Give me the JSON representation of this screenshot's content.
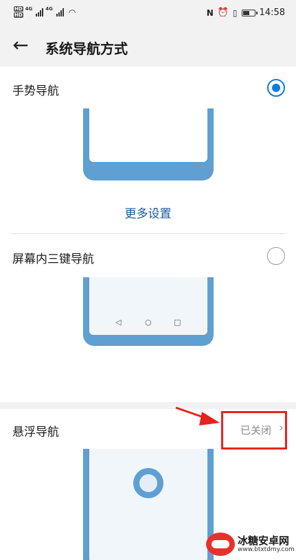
{
  "status_bar": {
    "hd_top": "HD",
    "hd_bottom": "HD",
    "network_1": "4G",
    "network_2": "4G",
    "time": "14:58",
    "icons": [
      "nfc-icon",
      "alarm-icon",
      "vibrate-icon",
      "battery-icon"
    ]
  },
  "header": {
    "title": "系统导航方式",
    "back_icon": "back-arrow-icon"
  },
  "options": {
    "gesture": {
      "label": "手势导航",
      "selected": true
    },
    "more_settings": "更多设置",
    "three_key": {
      "label": "屏幕内三键导航",
      "selected": false,
      "buttons": [
        "◁",
        "○",
        "□"
      ]
    },
    "floating": {
      "label": "悬浮导航",
      "status": "已关闭"
    }
  },
  "watermark": {
    "name": "冰糖安卓网",
    "url": "www.btxtdmy.com"
  },
  "colors": {
    "accent": "#0a7be0",
    "phone": "#5f9fd2",
    "highlight": "#e5231e"
  }
}
